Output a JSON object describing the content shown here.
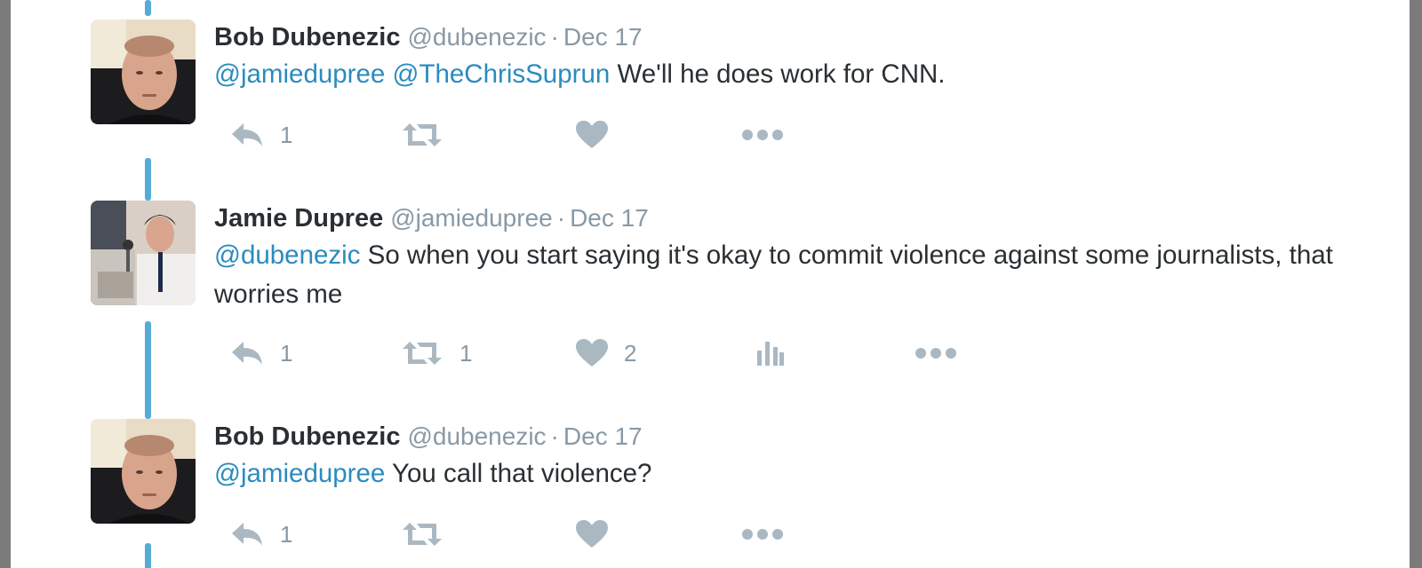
{
  "colors": {
    "thread_line": "#55acd6",
    "mention": "#2b8bbf",
    "action_icon": "#aab8c2",
    "muted_text": "#8899a6"
  },
  "tweets": [
    {
      "name": "Bob Dubenezic",
      "handle": "@dubenezic",
      "separator": "·",
      "date": "Dec 17",
      "mention1": "@jamiedupree",
      "mention2": "@TheChrisSuprun",
      "body": "We'll he does work for CNN.",
      "reply_count": "1",
      "icons": [
        "reply-icon",
        "retweet-icon",
        "like-icon",
        "more-icon"
      ]
    },
    {
      "name": "Jamie Dupree",
      "handle": "@jamiedupree",
      "separator": "·",
      "date": "Dec 17",
      "mention1": "@dubenezic",
      "body": "So when you start saying it's okay to commit violence against some journalists, that worries me",
      "reply_count": "1",
      "retweet_count": "1",
      "like_count": "2",
      "icons": [
        "reply-icon",
        "retweet-icon",
        "like-icon",
        "analytics-icon",
        "more-icon"
      ]
    },
    {
      "name": "Bob Dubenezic",
      "handle": "@dubenezic",
      "separator": "·",
      "date": "Dec 17",
      "mention1": "@jamiedupree",
      "body": "You call that violence?",
      "reply_count": "1",
      "icons": [
        "reply-icon",
        "retweet-icon",
        "like-icon",
        "more-icon"
      ]
    }
  ]
}
